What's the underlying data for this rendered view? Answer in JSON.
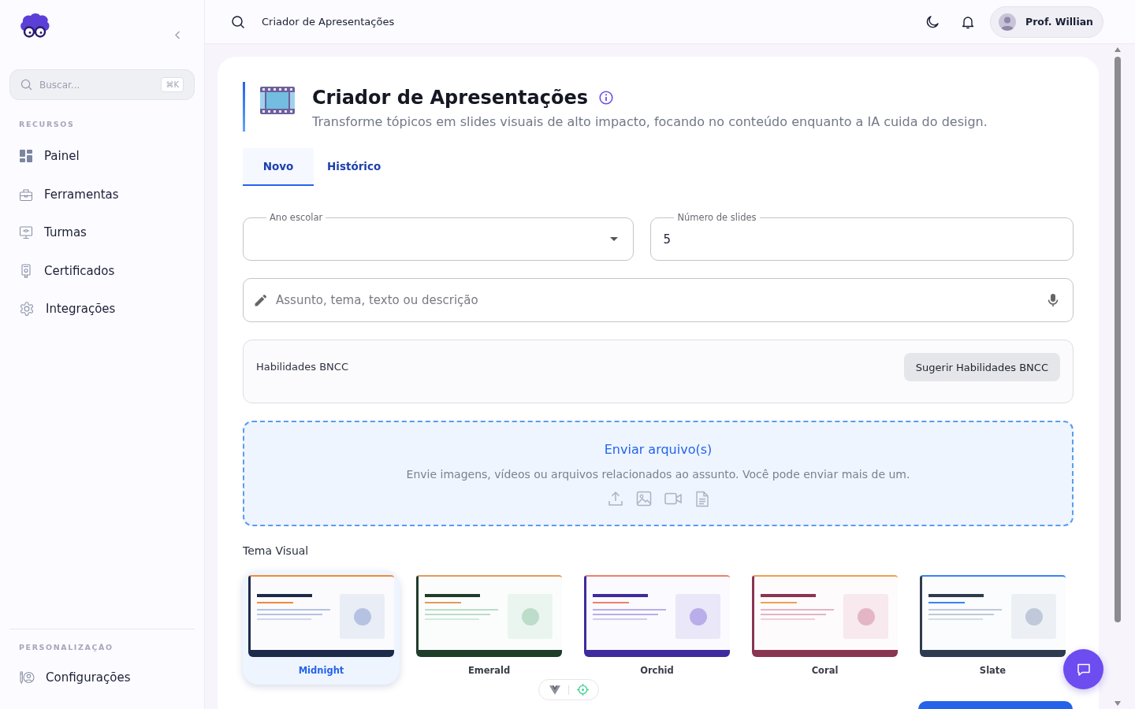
{
  "sidebar": {
    "search": {
      "placeholder": "Buscar...",
      "shortcut": "⌘K"
    },
    "sections": [
      {
        "heading": "RECURSOS",
        "items": [
          {
            "label": "Painel"
          },
          {
            "label": "Ferramentas"
          },
          {
            "label": "Turmas"
          },
          {
            "label": "Certificados"
          },
          {
            "label": "Integrações"
          }
        ]
      },
      {
        "heading": "PERSONALIZAÇÃO",
        "items": [
          {
            "label": "Configurações"
          }
        ]
      }
    ]
  },
  "topbar": {
    "title": "Criador de Apresentações",
    "user": {
      "name": "Prof. Willian"
    }
  },
  "header": {
    "title": "Criador de Apresentações",
    "subtitle": "Transforme tópicos em slides visuais de alto impacto, focando no conteúdo enquanto a IA cuida do design."
  },
  "tabs": [
    {
      "label": "Novo",
      "selected": true
    },
    {
      "label": "Histórico",
      "selected": false
    }
  ],
  "form": {
    "grade": {
      "label": "Ano escolar"
    },
    "slides": {
      "label": "Número de slides",
      "value": "5"
    },
    "topic": {
      "placeholder": "Assunto, tema, texto ou descrição"
    },
    "bncc": {
      "label": "Habilidades BNCC",
      "button": "Sugerir Habilidades BNCC"
    },
    "upload": {
      "title": "Enviar arquivo(s)",
      "description": "Envie imagens, vídeos ou arquivos relacionados ao assunto. Você pode enviar mais de um."
    }
  },
  "theme": {
    "label": "Tema Visual",
    "options": [
      {
        "name": "Midnight",
        "color": "#1e2a4a",
        "accent": {
          "color": "#f08a3a"
        },
        "selected": true
      },
      {
        "name": "Emerald",
        "color": "#1f3d2b",
        "accent": {
          "color": "#e39a5c"
        },
        "selected": false
      },
      {
        "name": "Orchid",
        "color": "#3f2a9e",
        "accent": {
          "color": "#f0806a"
        },
        "selected": false
      },
      {
        "name": "Coral",
        "color": "#8a3552",
        "accent": {
          "color": "#f0a050"
        },
        "selected": false
      },
      {
        "name": "Slate",
        "color": "#2f3b4f",
        "accent": {
          "color": "#3b82f6"
        },
        "selected": false
      }
    ]
  }
}
